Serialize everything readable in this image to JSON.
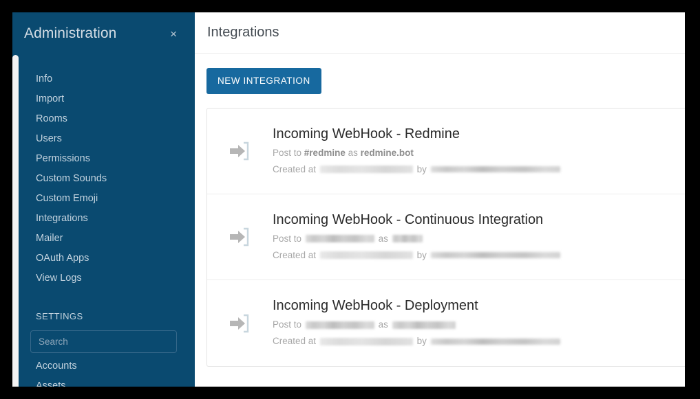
{
  "sidebar": {
    "title": "Administration",
    "close_icon": "close-icon",
    "close_label": "×",
    "items": [
      {
        "label": "Info"
      },
      {
        "label": "Import"
      },
      {
        "label": "Rooms"
      },
      {
        "label": "Users"
      },
      {
        "label": "Permissions"
      },
      {
        "label": "Custom Sounds"
      },
      {
        "label": "Custom Emoji"
      },
      {
        "label": "Integrations"
      },
      {
        "label": "Mailer"
      },
      {
        "label": "OAuth Apps"
      },
      {
        "label": "View Logs"
      }
    ],
    "settings_section_title": "SETTINGS",
    "search": {
      "value": "",
      "placeholder": "Search"
    },
    "settings_items": [
      {
        "label": "Accounts"
      },
      {
        "label": "Assets"
      }
    ],
    "background_color": "#0a4a70",
    "text_color": "#c2d2de"
  },
  "main": {
    "page_title": "Integrations",
    "new_integration_label": "NEW INTEGRATION",
    "accent_color": "#17699f",
    "integrations": [
      {
        "icon": "sign-in-arrow-icon",
        "name": "Incoming WebHook - Redmine",
        "post_to_prefix": "Post to",
        "channel": "#redmine",
        "channel_redacted": false,
        "as_label": "as",
        "bot": "redmine.bot",
        "bot_redacted": false,
        "created_prefix": "Created at",
        "created_at": "",
        "created_at_redacted": true,
        "by_label": "by",
        "created_by": "",
        "created_by_redacted": true
      },
      {
        "icon": "sign-in-arrow-icon",
        "name": "Incoming WebHook - Continuous Integration",
        "post_to_prefix": "Post to",
        "channel": "",
        "channel_redacted": true,
        "as_label": "as",
        "bot": "",
        "bot_redacted": true,
        "created_prefix": "Created at",
        "created_at": "",
        "created_at_redacted": true,
        "by_label": "by",
        "created_by": "",
        "created_by_redacted": true
      },
      {
        "icon": "sign-in-arrow-icon",
        "name": "Incoming WebHook - Deployment",
        "post_to_prefix": "Post to",
        "channel": "",
        "channel_redacted": true,
        "as_label": "as",
        "bot": "",
        "bot_redacted": true,
        "created_prefix": "Created at",
        "created_at": "",
        "created_at_redacted": true,
        "by_label": "by",
        "created_by": "",
        "created_by_redacted": true
      }
    ]
  }
}
